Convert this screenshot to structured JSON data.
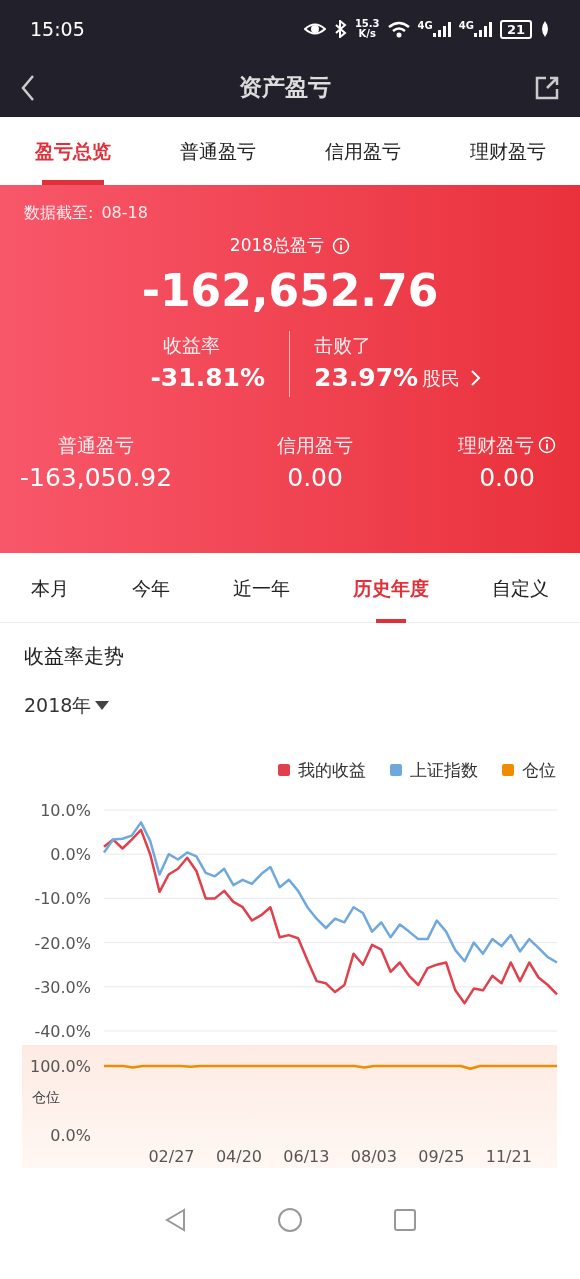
{
  "status_bar": {
    "time": "15:05",
    "net_speed": [
      "15.3",
      "K/s"
    ],
    "networks": [
      "4G",
      "4G"
    ],
    "battery": "21"
  },
  "toolbar": {
    "title": "资产盈亏"
  },
  "tabs": [
    {
      "label": "盈亏总览",
      "selected": true
    },
    {
      "label": "普通盈亏",
      "selected": false
    },
    {
      "label": "信用盈亏",
      "selected": false
    },
    {
      "label": "理财盈亏",
      "selected": false
    }
  ],
  "summary": {
    "data_date_label": "数据截至:",
    "data_date": "08-18",
    "total_label": "2018总盈亏",
    "total": "-162,652.76",
    "return_label": "收益率",
    "return_value": "-31.81%",
    "beat_label": "击败了",
    "beat_value": "23.97%",
    "beat_unit": "股民",
    "accounts": [
      {
        "label": "普通盈亏",
        "value": "-163,050.92",
        "info": false
      },
      {
        "label": "信用盈亏",
        "value": "0.00",
        "info": false
      },
      {
        "label": "理财盈亏",
        "value": "0.00",
        "info": true
      }
    ]
  },
  "periods": [
    {
      "label": "本月",
      "selected": false
    },
    {
      "label": "今年",
      "selected": false
    },
    {
      "label": "近一年",
      "selected": false
    },
    {
      "label": "历史年度",
      "selected": true
    },
    {
      "label": "自定义",
      "selected": false
    }
  ],
  "trend": {
    "title": "收益率走势",
    "year": "2018年",
    "chart_data": {
      "type": "line",
      "grid": true,
      "categories": [
        null,
        null,
        null,
        null,
        null,
        null,
        null,
        null,
        null,
        null,
        null,
        null,
        null,
        null,
        null,
        null,
        null,
        null,
        null,
        null,
        null,
        null,
        null,
        null,
        null,
        null,
        null,
        null,
        null,
        null,
        null,
        null,
        null,
        null,
        null,
        null,
        null,
        null,
        null,
        null,
        null,
        null,
        null,
        null,
        null,
        null,
        null,
        null,
        null,
        null
      ],
      "ylim": [
        -40,
        10
      ],
      "yticks": [
        {
          "value": 10,
          "label": "10.0%"
        },
        {
          "value": 0,
          "label": "0.0%"
        },
        {
          "value": -10,
          "label": "-10.0%"
        },
        {
          "value": -20,
          "label": "-20.0%"
        },
        {
          "value": -30,
          "label": "-30.0%"
        },
        {
          "value": -40,
          "label": "-40.0%"
        }
      ],
      "series": [
        {
          "name": "我的收益",
          "color": "#e0404c",
          "values": [
            1.7,
            3.3,
            1.3,
            3.3,
            5.5,
            0,
            -8.5,
            -4.6,
            -3.3,
            -0.8,
            -3.8,
            -10,
            -10,
            -8.3,
            -10.8,
            -12,
            -15,
            -13.8,
            -12,
            -18.8,
            -18.3,
            -19,
            -24,
            -28.7,
            -29.2,
            -31.2,
            -29.6,
            -22.5,
            -25,
            -20.5,
            -21.6,
            -26.6,
            -24.5,
            -27.5,
            -29.6,
            -25.8,
            -25,
            -24.5,
            -30.8,
            -33.7,
            -30.4,
            -30.8,
            -27.5,
            -29.2,
            -24.5,
            -28.7,
            -24.5,
            -27.9,
            -29.6,
            -31.7
          ]
        },
        {
          "name": "上证指数",
          "color": "#6fa8dc",
          "values": [
            0.4,
            3.3,
            3.5,
            4.2,
            7.2,
            3,
            -4.6,
            0,
            -1.2,
            0.4,
            -0.5,
            -4.2,
            -5,
            -3.3,
            -7,
            -5.8,
            -6.7,
            -4.5,
            -2.9,
            -7.5,
            -5.8,
            -8.3,
            -12,
            -14.6,
            -16.7,
            -14.6,
            -15.4,
            -12,
            -13.3,
            -17.5,
            -15.4,
            -18.8,
            -15.9,
            -17.5,
            -19.2,
            -19.2,
            -15,
            -17.5,
            -21.7,
            -24.2,
            -20,
            -22.5,
            -19.2,
            -20.8,
            -18.3,
            -22,
            -19.2,
            -21.2,
            -23.3,
            -24.5
          ]
        }
      ]
    }
  },
  "position": {
    "chart_data": {
      "type": "line",
      "ylabel": "仓位",
      "categories": [
        null,
        null,
        null,
        null,
        null,
        null,
        null,
        "02/27",
        null,
        null,
        null,
        null,
        null,
        null,
        "04/20",
        null,
        null,
        null,
        null,
        null,
        null,
        "06/13",
        null,
        null,
        null,
        null,
        null,
        null,
        "08/03",
        null,
        null,
        null,
        null,
        null,
        null,
        "09/25",
        null,
        null,
        null,
        null,
        null,
        null,
        "11/21",
        null,
        null,
        null,
        null,
        null
      ],
      "ylim": [
        0,
        100
      ],
      "yticks": [
        {
          "value": 100,
          "label": "100.0%"
        },
        {
          "value": 0,
          "label": "0.0%"
        }
      ],
      "series": [
        {
          "name": "仓位",
          "color": "#f08c00",
          "values": [
            100,
            100,
            100,
            98,
            100,
            100,
            100,
            100,
            100,
            99,
            100,
            100,
            100,
            100,
            100,
            100,
            100,
            100,
            100,
            100,
            100,
            100,
            100,
            100,
            100,
            100,
            100,
            98,
            100,
            100,
            100,
            100,
            100,
            100,
            100,
            100,
            100,
            100,
            96,
            100,
            100,
            100,
            100,
            100,
            100,
            100,
            100,
            100
          ]
        }
      ]
    }
  }
}
